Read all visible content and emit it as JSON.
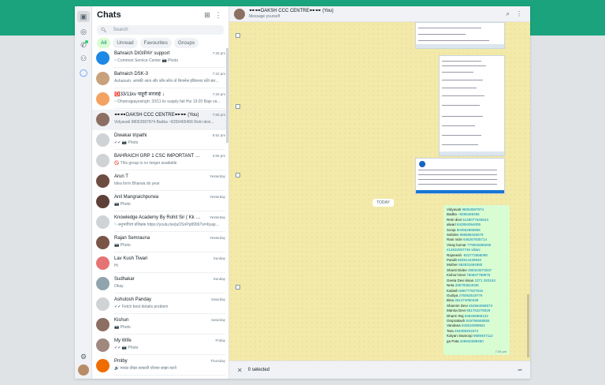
{
  "rail": {
    "icons": [
      "chats-icon",
      "status-icon",
      "channels-icon",
      "communities-icon",
      "meta-ai-icon",
      "settings-icon"
    ]
  },
  "chatlist": {
    "title": "Chats",
    "search_placeholder": "Search",
    "filters": [
      "All",
      "Unread",
      "Favourites",
      "Groups"
    ],
    "rows": [
      {
        "name": "Bahraich DIGIPAY support",
        "preview": "~ Common Service Center 📷 Photo",
        "time": "7:28 pm",
        "color": "#1e88e5"
      },
      {
        "name": "Bahraich DSK-3",
        "preview": "Ashutosh: आपकी आज और कौन सोच तो बिजनेस इंडियानए प्रति बार...",
        "time": "7:22 pm",
        "color": "#c8a27c"
      },
      {
        "name": "🅾️33/11kv पाहूरी सरजाई ↓",
        "preview": "~ Dhanrajpayesingh: 33/11 kv supply fail Hui 19:20 Baje vaise...",
        "time": "7:20 pm",
        "color": "#f4a261"
      },
      {
        "name": "🕶️🕶️DAKSH CCC CENTRE🕶️🕶️ (You)",
        "preview": "Vidyavati 98063587874 Badka ~8265465456 Retri devi...",
        "time": "7:05 pm",
        "color": "#8d6e63"
      },
      {
        "name": "Diwakar tripathi",
        "preview": "✔✔ 📷 Photo",
        "time": "6:52 pm",
        "color": "#d0d3d6"
      },
      {
        "name": "BAHRAICH GRP 1 CSC IMPORTANT UPDAT...",
        "preview": "🚫 This group is no longer available",
        "time": "2:06 pm",
        "color": "#d0d3d6"
      },
      {
        "name": "Arun T",
        "preview": "Idea form Bharwa do year",
        "time": "Yesterday",
        "color": "#6d4c41"
      },
      {
        "name": "Anil Mangraichpurwa",
        "preview": "📷 Photo",
        "time": "Yesterday",
        "color": "#5d4037"
      },
      {
        "name": "Knowledge Academy By Rohit Sir ( Kk Sir )",
        "preview": "~ अनुभवीएवं प्रशिक्षक https://youtu.be/juOSnPp8996?si=byapo5...",
        "time": "Yesterday",
        "color": "#d0d3d6"
      },
      {
        "name": "Rajan Semrauna",
        "preview": "📷 Photo",
        "time": "Yesterday",
        "color": "#795548"
      },
      {
        "name": "Lav Kush Tiwari",
        "preview": "Hi",
        "time": "Sunday",
        "color": "#e57373"
      },
      {
        "name": "Sudhakar",
        "preview": "Okay",
        "time": "Sunday",
        "color": "#90a4ae"
      },
      {
        "name": "Ashutosh Panday",
        "preview": "✔✔ Fetch best details problem",
        "time": "Saturday",
        "color": "#d0d3d6"
      },
      {
        "name": "Kishun",
        "preview": "📷 Photo",
        "time": "Saturday",
        "color": "#8d6e63"
      },
      {
        "name": "My Wife",
        "preview": "✔✔ 📷 Photo",
        "time": "Friday",
        "color": "#a1887f"
      },
      {
        "name": "Pmlby",
        "preview": "🔊 मराठा तीखा सरकारी योजना साझा करने",
        "time": "Thursday",
        "color": "#ef6c00"
      }
    ]
  },
  "chat": {
    "title": "🕶️🕶️DAKSH CCC CENTRE🕶️🕶️ (You)",
    "subtitle": "Message yourself",
    "day_chip": "TODAY",
    "bubble_lines": [
      {
        "n": "Vidyavati",
        "p": "98063587874"
      },
      {
        "n": "Badka",
        "p": "~8265465456"
      },
      {
        "n": "Retri devi",
        "p": "5148077640643"
      },
      {
        "n": "alwari",
        "p": "842894064005"
      },
      {
        "n": "Sonja",
        "p": "804552865956"
      },
      {
        "n": "Sahdev",
        "p": "968688445079"
      },
      {
        "n": "Rani nicle",
        "p": "646267935714"
      },
      {
        "n": "Vinay kumar",
        "p": "779002868290"
      },
      {
        "n": "",
        "p": "412632057745 villani"
      },
      {
        "n": "Rajneesh",
        "p": "-842772668099"
      },
      {
        "n": "Pandit",
        "p": "683914439940"
      },
      {
        "n": "Mother",
        "p": "884831694580"
      },
      {
        "n": "Shanti Didee",
        "p": "298343873037"
      },
      {
        "n": "Kishori Devi",
        "p": "750837768975"
      },
      {
        "n": "Geeta Devi kisan",
        "p": "2371 283163"
      },
      {
        "n": "Neta",
        "p": "285793524635"
      },
      {
        "n": "Kailash",
        "p": "586777927816"
      },
      {
        "n": "Gudiya",
        "p": "276053518776"
      },
      {
        "n": "Bina",
        "p": "361474050438"
      },
      {
        "n": "Shamim Devi",
        "p": "454564069573"
      },
      {
        "n": "Mamta Devi",
        "p": "851752278029"
      },
      {
        "n": "Dharm Raj",
        "p": "636336968122"
      },
      {
        "n": "Omprakash",
        "p": "919766568555"
      },
      {
        "n": "Vandana",
        "p": "843610089941"
      },
      {
        "n": "Tara",
        "p": "494008291874"
      },
      {
        "n": "Kalyan Swaroop",
        "p": "9589457112"
      },
      {
        "n": "ga Pata",
        "p": "348633388450"
      }
    ],
    "bubble_time": "7:05 pm",
    "selection_text": "0 selected"
  }
}
